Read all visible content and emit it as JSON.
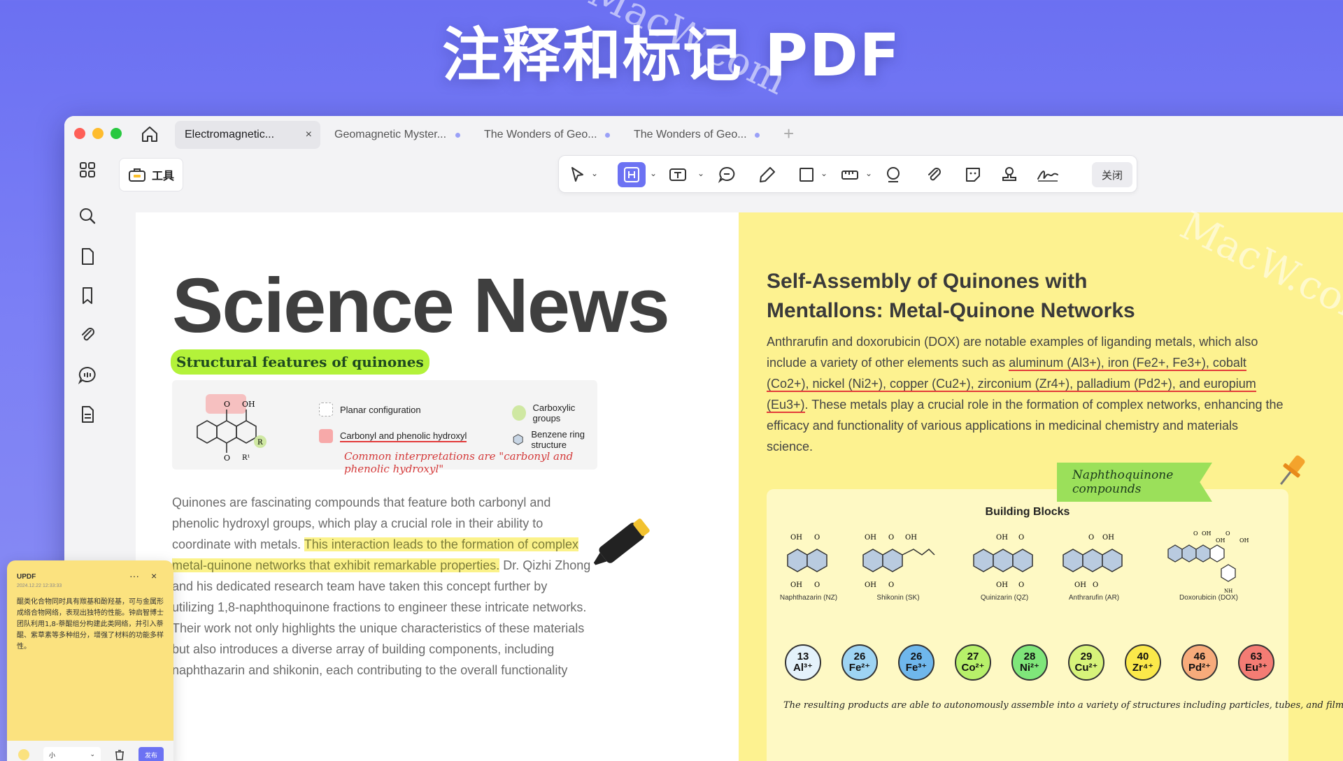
{
  "hero": {
    "title": "注释和标记 PDF"
  },
  "watermark": "MacW.com",
  "tabs": [
    {
      "label": "Electromagnetic...",
      "close": "×"
    },
    {
      "label": "Geomagnetic Myster..."
    },
    {
      "label": "The Wonders of Geo..."
    },
    {
      "label": "The Wonders of Geo..."
    }
  ],
  "tab_add": "+",
  "tools": {
    "label": "工具"
  },
  "toolbar": {
    "close_label": "关闭"
  },
  "left": {
    "headline": "Science News",
    "highlight": "Structural features of quinones",
    "diagram": {
      "legend": [
        "Planar configuration",
        "Carboxylic groups",
        "Carbonyl and phenolic hydroxyl",
        "Benzene ring structure"
      ],
      "note": "Common interpretations are \"carbonyl and phenolic hydroxyl\"",
      "atoms": {
        "o": "O",
        "oh": "OH",
        "r": "R",
        "r1": "R¹"
      }
    },
    "body": {
      "p1": "Quinones are fascinating compounds that feature both carbonyl and phenolic hydroxyl groups, which play a crucial role in their ability to coordinate with metals.",
      "p2_hl": "This interaction leads to the formation of complex metal-quinone networks that exhibit remarkable properties.",
      "p3": "Dr. Qizhi Zhong and his dedicated research team have taken this concept further by utilizing 1,8-naphthoquinone fractions to engineer these intricate networks. Their work not only highlights the unique characteristics of these materials but also introduces a diverse array of building components, including naphthazarin and shikonin, each contributing to the overall functionality"
    }
  },
  "right": {
    "title": "Self-Assembly of Quinones with Mentallons: Metal-Quinone Networks",
    "body_a": "Anthrarufin and doxorubicin (DOX) are notable examples of liganding metals, which also include a variety of other elements such as",
    "body_ul": "aluminum (Al3+), iron (Fe2+, Fe3+), cobalt (Co2+), nickel (Ni2+), copper (Cu2+), zirconium (Zr4+), palladium (Pd2+), and europium (Eu3+)",
    "body_b": ". These metals play a crucial role in the formation of complex networks, enhancing the efficacy and functionality of various applications in medicinal chemistry and materials science.",
    "flag": "Naphthoquinone compounds",
    "building_blocks": {
      "title": "Building Blocks",
      "molecules": [
        "Naphthazarin (NZ)",
        "Shikonin (SK)",
        "Quinizarin (QZ)",
        "Anthrarufin (AR)",
        "Doxorubicin (DOX)"
      ],
      "ions": [
        {
          "num": "13",
          "sym": "Al³⁺",
          "color": "#e4f2fb"
        },
        {
          "num": "26",
          "sym": "Fe²⁺",
          "color": "#9ed4f3"
        },
        {
          "num": "26",
          "sym": "Fe³⁺",
          "color": "#6fb7ec"
        },
        {
          "num": "27",
          "sym": "Co²⁺",
          "color": "#b7f06a"
        },
        {
          "num": "28",
          "sym": "Ni²⁺",
          "color": "#7fe67a"
        },
        {
          "num": "29",
          "sym": "Cu²⁺",
          "color": "#d7f37a"
        },
        {
          "num": "40",
          "sym": "Zr⁴⁺",
          "color": "#fbe94a"
        },
        {
          "num": "46",
          "sym": "Pd²⁺",
          "color": "#f7ab7b"
        },
        {
          "num": "63",
          "sym": "Eu³⁺",
          "color": "#f47c74"
        }
      ],
      "footnote": "The resulting products are able to autonomously assemble into a variety of structures including particles, tubes, and films."
    }
  },
  "note": {
    "author": "UPDF",
    "date": "2024.12.22 12:33:33",
    "menu": "···",
    "close": "×",
    "body": "醌类化合物同时具有羰基和酚羟基，可与金属形成络合物网络，表现出独特的性能。钟启智博士团队利用1,8-萘醌组分构建此类网络，并引入萘醌、紫草素等多种组分，增强了材料的功能多样性。",
    "size": "小",
    "post": "发布"
  }
}
